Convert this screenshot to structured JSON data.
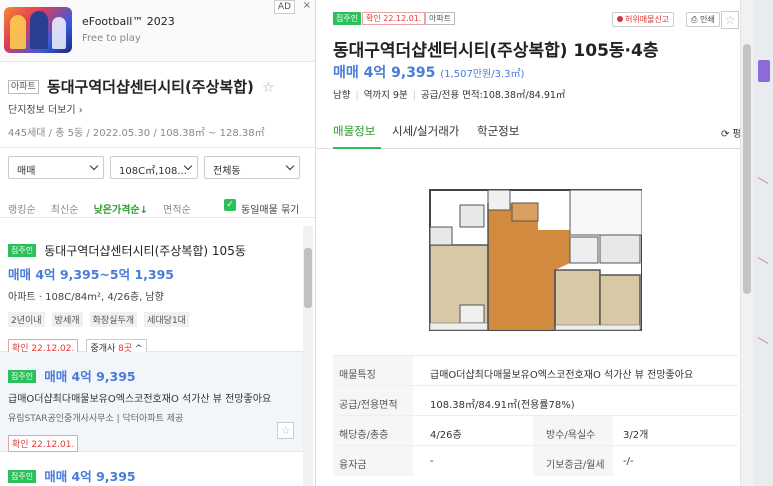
{
  "ad": {
    "title": "eFootball™ 2023",
    "subtitle": "Free to play",
    "badge": "AD",
    "close": "×"
  },
  "complex": {
    "tag": "아파트",
    "name": "동대구역더샵센터시티(주상복합)",
    "more": "단지정보 더보기 ›",
    "info": "445세대 / 총 5동 / 2022.05.30 / 108.38㎡ ~ 128.38㎡"
  },
  "filters": [
    {
      "label": "매매"
    },
    {
      "label": "108C㎡,108..."
    },
    {
      "label": "전체동"
    }
  ],
  "sorts": {
    "items": [
      "랭킹순",
      "최신순",
      "낮은가격순↓",
      "면적순"
    ],
    "active_index": 2,
    "same_listing": "동일매물 묶기"
  },
  "listings": [
    {
      "tag": "집주인",
      "title": "동대구역더샵센터시티(주상복합) 105동",
      "price": "매매 4억 9,395~5억 1,395",
      "type": "아파트 · 108C/84m², 4/26층, 남향",
      "chips": [
        "2년이내",
        "방세개",
        "화장실두개",
        "세대당1대"
      ],
      "confirm": "확인 22.12.02.",
      "agents_prefix": "중개사 ",
      "agents_count": "8곳",
      "agents_suffix": " ^"
    },
    {
      "tag": "집주인",
      "price": "매매 4억 9,395",
      "desc": "급매O더샵최다매물보유O엑스코전호재O 석가산 뷰 전망좋아요",
      "broker": "유림STAR공인중개사사무소 | 닥터아파트 제공",
      "confirm": "확인 22.12.01."
    },
    {
      "tag": "집주인",
      "price": "매매 4억 9,395"
    }
  ],
  "detail": {
    "tag": "집주인",
    "confirm": "확인 22.12.01.",
    "apt": "아파트",
    "report": "허위매물신고",
    "print": "인쇄",
    "title": "동대구역더샵센터시티(주상복합) 105동·4층",
    "price": "매매 4억 9,395",
    "price_unit": "(1,507만원/3.3㎡)",
    "spec": [
      "남향",
      "역까지 9분",
      "공급/전용 면적:108.38㎡/84.91㎡"
    ],
    "tabs": [
      "매물정보",
      "시세/실거래가",
      "학군정보"
    ],
    "active_tab": 0,
    "refresh": "⟳ 평",
    "rows": [
      {
        "k": "매물특징",
        "v": "급매O더샵최다매물보유O엑스코전호재O 석가산 뷰 전망좋아요"
      },
      {
        "k": "공급/전용면적",
        "v": "108.38㎡/84.91㎡(전용률78%)"
      },
      {
        "k": "해당층/총층",
        "v": "4/26층",
        "k2": "방수/욕실수",
        "v2": "3/2개"
      },
      {
        "k": "융자금",
        "v": "-",
        "k2": "기보증금/월세",
        "v2": "-/-"
      }
    ]
  },
  "colors": {
    "green": "#2dbf5b",
    "blue_price": "#4a7bd8",
    "red": "#e23b3b"
  }
}
